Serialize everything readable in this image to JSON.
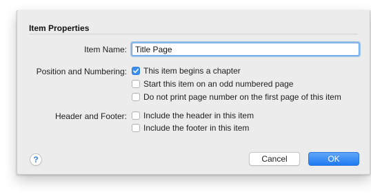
{
  "section": {
    "title": "Item Properties"
  },
  "item_name": {
    "label": "Item Name:",
    "value": "Title Page"
  },
  "position_numbering": {
    "label": "Position and Numbering:",
    "options": [
      {
        "label": "This item begins a chapter",
        "checked": true
      },
      {
        "label": "Start this item on an odd numbered page",
        "checked": false
      },
      {
        "label": "Do not print page number on the first page of this item",
        "checked": false
      }
    ]
  },
  "header_footer": {
    "label": "Header and Footer:",
    "options": [
      {
        "label": "Include the header in this item",
        "checked": false
      },
      {
        "label": "Include the footer in this item",
        "checked": false
      }
    ]
  },
  "footer": {
    "help_icon": "question-mark-icon",
    "help_label": "?",
    "cancel_label": "Cancel",
    "ok_label": "OK"
  },
  "colors": {
    "accent": "#3b8ef0",
    "sheet_bg": "#ececec"
  }
}
